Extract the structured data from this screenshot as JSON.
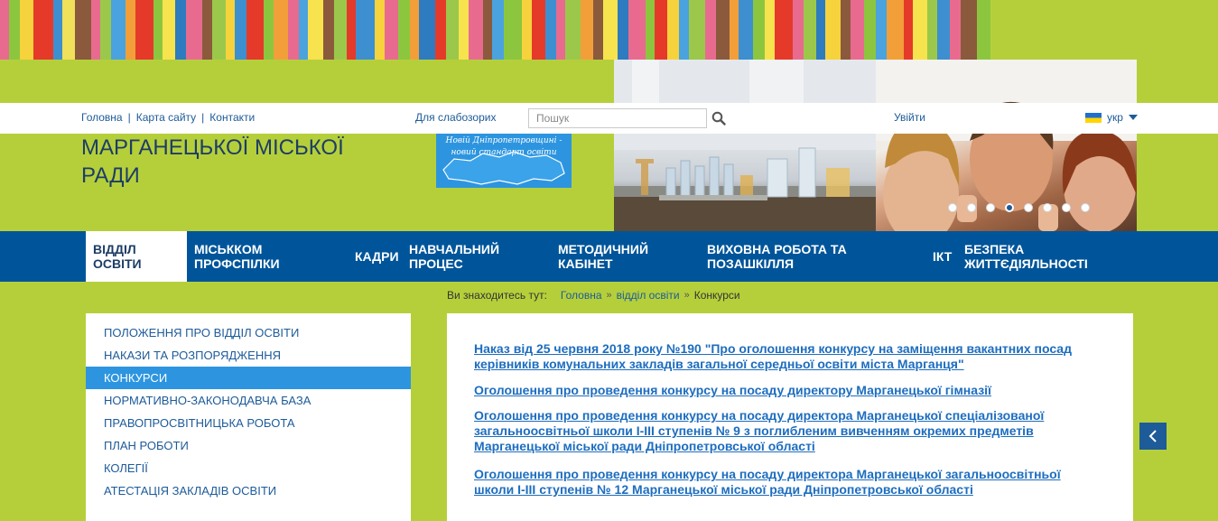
{
  "stripes": {
    "colors": [
      "#e86b8f",
      "#8cc63f",
      "#f6d23c",
      "#e53a2a",
      "#3d8fd0",
      "#f0e05a",
      "#8b5a3c",
      "#e86b8f",
      "#9bc84a",
      "#4aa3df",
      "#f29f3a",
      "#e53a2a",
      "#8cc63f",
      "#f7e34d",
      "#2e7bbf",
      "#e86b8f",
      "#8b5a3c",
      "#9bc84a",
      "#f6d23c",
      "#3d8fd0",
      "#e53a2a",
      "#8cc63f",
      "#f29f3a",
      "#e86b8f",
      "#4aa3df",
      "#f7e34d",
      "#8b5a3c",
      "#9bc84a",
      "#e53a2a",
      "#3d8fd0",
      "#f6d23c",
      "#e86b8f",
      "#8cc63f",
      "#f29f3a",
      "#2e7bbf",
      "#e53a2a",
      "#9bc84a",
      "#f7e34d",
      "#e86b8f",
      "#8b5a3c",
      "#4aa3df",
      "#8cc63f",
      "#f6d23c",
      "#e53a2a",
      "#3d8fd0",
      "#e86b8f",
      "#9bc84a",
      "#f29f3a",
      "#8b5a3c",
      "#f7e34d",
      "#2e7bbf",
      "#e86b8f",
      "#8cc63f",
      "#e53a2a",
      "#f6d23c",
      "#4aa3df",
      "#9bc84a",
      "#e86b8f",
      "#8b5a3c",
      "#f29f3a",
      "#3d8fd0",
      "#8cc63f",
      "#f7e34d",
      "#e53a2a",
      "#e86b8f",
      "#9bc84a",
      "#2e7bbf",
      "#f6d23c",
      "#8b5a3c",
      "#e86b8f",
      "#8cc63f",
      "#4aa3df",
      "#f29f3a",
      "#e53a2a",
      "#f7e34d",
      "#9bc84a",
      "#3d8fd0",
      "#e86b8f",
      "#8b5a3c",
      "#8cc63f"
    ]
  },
  "topbar": {
    "links": [
      "Головна",
      "Карта сайту",
      "Контакти"
    ],
    "vision_label": "Для слабозорих",
    "search_placeholder": "Пошук",
    "login_label": "Увійти",
    "lang_label": "укр"
  },
  "header": {
    "title_line1": "МАРГАНЕЦЬКОЇ МІСЬКОЇ",
    "title_line2": "РАДИ",
    "logo_line1": "Новій Дніпропетровщині -",
    "logo_line2": "новий стандарт освіти",
    "slider_active_index": 4,
    "slider_count": 8
  },
  "mainnav": {
    "items": [
      {
        "line1": "ВІДДІЛ",
        "line2": "ОСВІТИ"
      },
      {
        "line1": "МІСЬККОМ",
        "line2": "ПРОФСПІЛКИ"
      },
      {
        "line1": "КАДРИ",
        "line2": ""
      },
      {
        "line1": "НАВЧАЛЬНИЙ",
        "line2": "ПРОЦЕС"
      },
      {
        "line1": "МЕТОДИЧНИЙ",
        "line2": "КАБІНЕТ"
      },
      {
        "line1": "ВИХОВНА РОБОТА ТА",
        "line2": "ПОЗАШКІЛЛЯ"
      },
      {
        "line1": "ІКТ",
        "line2": ""
      },
      {
        "line1": "БЕЗПЕКА",
        "line2": "ЖИТТЄДІЯЛЬНОСТІ"
      }
    ]
  },
  "breadcrumb": {
    "label": "Ви знаходитесь тут:",
    "items": [
      "Головна",
      "відділ освіти",
      "Конкурси"
    ]
  },
  "sidebar": {
    "items": [
      "ПОЛОЖЕННЯ ПРО ВІДДІЛ ОСВІТИ",
      "НАКАЗИ ТА РОЗПОРЯДЖЕННЯ",
      "КОНКУРСИ",
      "НОРМАТИВНО-ЗАКОНОДАВЧА БАЗА",
      "ПРАВОПРОСВІТНИЦЬКА РОБОТА",
      "ПЛАН РОБОТИ",
      "КОЛЕГІЇ",
      "АТЕСТАЦІЯ ЗАКЛАДІВ ОСВІТИ"
    ],
    "active_index": 2
  },
  "content": {
    "links": [
      [
        "Наказ від 25 червня 2018 року №190 \"Про оголошення конкурсу на заміщення вакантних посад",
        "керівників комунальних закладів загальної середньої освіти міста Марганця\""
      ],
      [
        "Оголошення про проведення конкурсу на посаду директору Марганецької гімназії"
      ],
      [
        "Оголошення про проведення конкурсу на посаду директора Марганецької спеціалізованої",
        "загальноосвітньої школи І-ІІІ ступенів № 9 з поглибленим вивченням окремих предметів",
        "Марганецької міської ради Дніпропетровської області"
      ],
      [
        "Оголошення про проведення конкурсу на посаду директора Марганецької загальноосвітньої",
        "школи І-ІІІ ступенів № 12 Марганецької міської ради Дніпропетровської області"
      ]
    ]
  },
  "colors": {
    "page_bg": "#b5cf3b",
    "nav_bg": "#00559a",
    "active_side": "#2d95e0",
    "link": "#1d6dbf",
    "title": "#1d3d66"
  }
}
